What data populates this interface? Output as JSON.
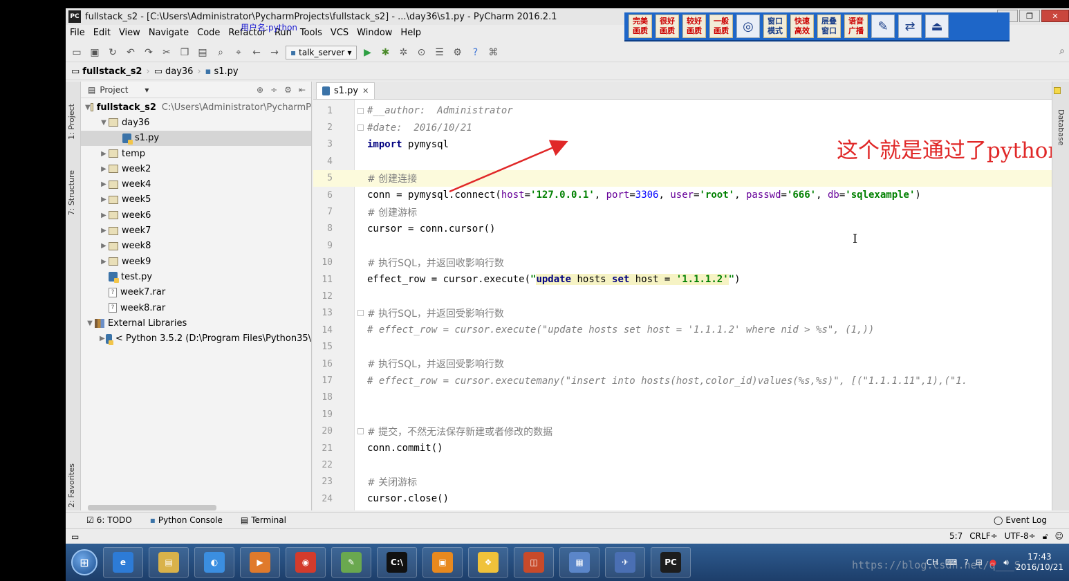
{
  "window": {
    "title": "fullstack_s2 - [C:\\Users\\Administrator\\PycharmProjects\\fullstack_s2] - ...\\day36\\s1.py - PyCharm 2016.2.1",
    "logo": "PC",
    "controls": [
      "–",
      "❐",
      "✕"
    ]
  },
  "quality_toolbar": {
    "buttons": [
      "完美\n画质",
      "很好\n画质",
      "较好\n画质",
      "一般\n画质"
    ],
    "extra": [
      "窗口\n模式",
      "快速\n高效",
      "层叠\n窗口",
      "语音\n广播"
    ]
  },
  "overlay_username": "用户名:python",
  "menu": [
    "File",
    "Edit",
    "View",
    "Navigate",
    "Code",
    "Refactor",
    "Run",
    "Tools",
    "VCS",
    "Window",
    "Help"
  ],
  "toolbar": {
    "run_config": "talk_server",
    "icons": [
      "open-icon",
      "save-icon",
      "sync-icon",
      "undo-icon",
      "redo-icon",
      "cut-icon",
      "copy-icon",
      "paste-icon",
      "find-icon",
      "replace-icon",
      "back-icon",
      "forward-icon"
    ]
  },
  "breadcrumb": [
    "fullstack_s2",
    "day36",
    "s1.py"
  ],
  "left_strip_tabs": [
    "1: Project",
    "7: Structure",
    "2: Favorites"
  ],
  "project_panel": {
    "header": "Project",
    "tree": [
      {
        "label": "fullstack_s2",
        "path": "C:\\Users\\Administrator\\PycharmP",
        "type": "folder",
        "level": 0,
        "expanded": true,
        "bold": true
      },
      {
        "label": "day36",
        "type": "folder",
        "level": 1,
        "expanded": true
      },
      {
        "label": "s1.py",
        "type": "py",
        "level": 2,
        "selected": true
      },
      {
        "label": "temp",
        "type": "folder",
        "level": 1
      },
      {
        "label": "week2",
        "type": "folder",
        "level": 1
      },
      {
        "label": "week4",
        "type": "folder",
        "level": 1
      },
      {
        "label": "week5",
        "type": "folder",
        "level": 1
      },
      {
        "label": "week6",
        "type": "folder",
        "level": 1
      },
      {
        "label": "week7",
        "type": "folder",
        "level": 1
      },
      {
        "label": "week8",
        "type": "folder",
        "level": 1
      },
      {
        "label": "week9",
        "type": "folder",
        "level": 1
      },
      {
        "label": "test.py",
        "type": "py",
        "level": 1
      },
      {
        "label": "week7.rar",
        "type": "file",
        "level": 1
      },
      {
        "label": "week8.rar",
        "type": "file",
        "level": 1
      },
      {
        "label": "External Libraries",
        "type": "lib",
        "level": 0,
        "expanded": true
      },
      {
        "label": "< Python 3.5.2 (D:\\Program Files\\Python35\\",
        "type": "pylib",
        "level": 1
      }
    ]
  },
  "editor": {
    "tab": "s1.py",
    "current_line": 5,
    "lines": [
      {
        "n": "1",
        "segs": [
          [
            "c",
            "#__author:  Administrator"
          ]
        ]
      },
      {
        "n": "2",
        "segs": [
          [
            "c",
            "#date:  2016/10/21"
          ]
        ]
      },
      {
        "n": "3",
        "segs": [
          [
            "k",
            "import "
          ],
          [
            "t",
            "pymysql"
          ]
        ]
      },
      {
        "n": "4",
        "segs": []
      },
      {
        "n": "5",
        "segs": [
          [
            "cc",
            "# 创建连接"
          ]
        ]
      },
      {
        "n": "6",
        "segs": [
          [
            "t",
            "conn = pymysql.connect("
          ],
          [
            "p",
            "host"
          ],
          [
            "t",
            "="
          ],
          [
            "s",
            "'127.0.0.1'"
          ],
          [
            "t",
            ", "
          ],
          [
            "p",
            "port"
          ],
          [
            "t",
            "="
          ],
          [
            "num",
            "3306"
          ],
          [
            "t",
            ", "
          ],
          [
            "p",
            "user"
          ],
          [
            "t",
            "="
          ],
          [
            "s",
            "'root'"
          ],
          [
            "t",
            ", "
          ],
          [
            "p",
            "passwd"
          ],
          [
            "t",
            "="
          ],
          [
            "s",
            "'666'"
          ],
          [
            "t",
            ", "
          ],
          [
            "p",
            "db"
          ],
          [
            "t",
            "="
          ],
          [
            "s",
            "'sqlexample'"
          ],
          [
            "t",
            ")"
          ]
        ]
      },
      {
        "n": "7",
        "segs": [
          [
            "cc",
            "# 创建游标"
          ]
        ]
      },
      {
        "n": "8",
        "segs": [
          [
            "t",
            "cursor = conn.cursor()"
          ]
        ]
      },
      {
        "n": "9",
        "segs": []
      },
      {
        "n": "10",
        "segs": [
          [
            "cc",
            "# 执行SQL，并返回收影响行数"
          ]
        ]
      },
      {
        "n": "11",
        "segs": [
          [
            "t",
            "effect_row = cursor.execute("
          ],
          [
            "s",
            "\""
          ],
          [
            "hk",
            "update"
          ],
          [
            "h",
            " hosts "
          ],
          [
            "hk",
            "set"
          ],
          [
            "h",
            " host = "
          ],
          [
            "hs",
            "'1.1.1.2'"
          ],
          [
            "s",
            "\""
          ],
          [
            "t",
            ")"
          ]
        ]
      },
      {
        "n": "12",
        "segs": []
      },
      {
        "n": "13",
        "segs": [
          [
            "cc",
            "# 执行SQL，并返回受影响行数"
          ]
        ]
      },
      {
        "n": "14",
        "segs": [
          [
            "c",
            "# effect_row = cursor.execute(\"update hosts set host = '1.1.1.2' where nid > %s\", (1,))"
          ]
        ]
      },
      {
        "n": "15",
        "segs": []
      },
      {
        "n": "16",
        "segs": [
          [
            "cc",
            "# 执行SQL，并返回受影响行数"
          ]
        ]
      },
      {
        "n": "17",
        "segs": [
          [
            "c",
            "# effect_row = cursor.executemany(\"insert into hosts(host,color_id)values(%s,%s)\", [(\"1.1.1.11\",1),(\"1."
          ]
        ]
      },
      {
        "n": "18",
        "segs": []
      },
      {
        "n": "19",
        "segs": []
      },
      {
        "n": "20",
        "segs": [
          [
            "cc",
            "# 提交，不然无法保存新建或者修改的数据"
          ]
        ]
      },
      {
        "n": "21",
        "segs": [
          [
            "t",
            "conn.commit()"
          ]
        ]
      },
      {
        "n": "22",
        "segs": []
      },
      {
        "n": "23",
        "segs": [
          [
            "cc",
            "# 关闭游标"
          ]
        ]
      },
      {
        "n": "24",
        "segs": [
          [
            "t",
            "cursor.close()"
          ]
        ]
      }
    ]
  },
  "annotation": "这个就是通过了python链接了数据库。",
  "right_strip_tab": "Database",
  "bottom_tabs": [
    "6: TODO",
    "Python Console",
    "Terminal"
  ],
  "event_log": "Event Log",
  "status": {
    "position": "5:7",
    "line_sep": "CRLF÷",
    "encoding": "UTF-8÷"
  },
  "taskbar": {
    "apps": [
      {
        "name": "ie",
        "color": "#2d7bd6",
        "glyph": "e"
      },
      {
        "name": "explorer",
        "color": "#d9b24a",
        "glyph": "▤"
      },
      {
        "name": "browser-blue",
        "color": "#3b8ee0",
        "glyph": "◐"
      },
      {
        "name": "media",
        "color": "#e07a2c",
        "glyph": "▶"
      },
      {
        "name": "chrome",
        "color": "#d33b2c",
        "glyph": "◉"
      },
      {
        "name": "notepad",
        "color": "#6aa84f",
        "glyph": "✎"
      },
      {
        "name": "cmd",
        "color": "#111111",
        "glyph": "C:\\"
      },
      {
        "name": "briefcase",
        "color": "#e8891e",
        "glyph": "▣"
      },
      {
        "name": "folder-yellow",
        "color": "#f0c23a",
        "glyph": "❖"
      },
      {
        "name": "slides",
        "color": "#c84a2a",
        "glyph": "◫"
      },
      {
        "name": "control-panel",
        "color": "#5b86c9",
        "glyph": "▦"
      },
      {
        "name": "network",
        "color": "#4a6fb3",
        "glyph": "✈"
      },
      {
        "name": "pycharm",
        "color": "#1d1d1d",
        "glyph": "PC"
      }
    ],
    "tray_lang": "CH",
    "time": "17:43",
    "date": "2016/10/21"
  },
  "watermark": "https://blog.csdn.net/q___S"
}
